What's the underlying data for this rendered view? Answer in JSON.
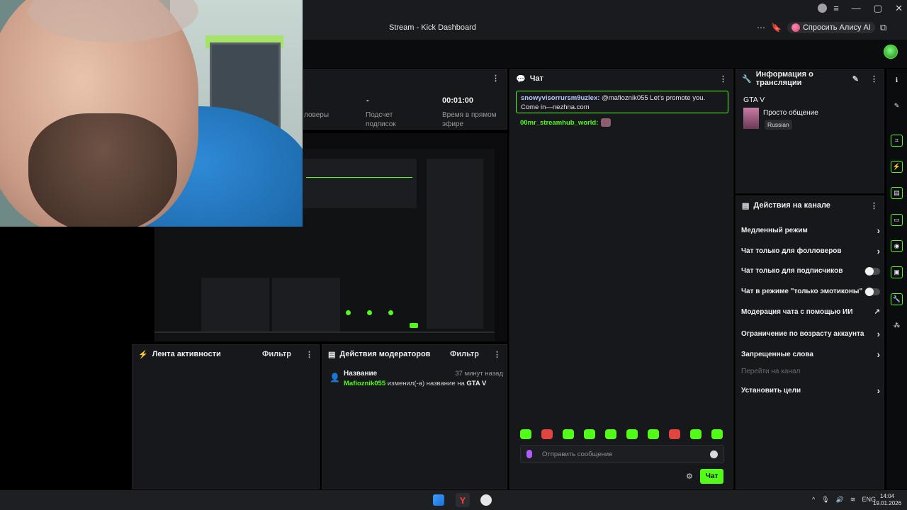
{
  "browser": {
    "page_title": "Stream - Kick Dashboard",
    "alice_button": "Спросить Алису AI",
    "more_icon": "⋯",
    "window_controls": [
      "≡",
      "—",
      "▢",
      "✕"
    ]
  },
  "stats": {
    "followers_label": "ловеры",
    "subs_value": "-",
    "subs_label_1": "Подсчет",
    "subs_label_2": "подписок",
    "live_value": "00:01:00",
    "live_label_1": "Время в прямом",
    "live_label_2": "эфире"
  },
  "chat": {
    "title": "Чат",
    "pinned_user": "snowyvisorrursm9uzlex:",
    "pinned_text": "@mafioznik055 Let's promote you. Come in—nezhna.com",
    "message_user": "00mr_streamhub_world:",
    "input_placeholder": "Отправить сообщение",
    "send_label": "Чат"
  },
  "stream_info": {
    "title": "Информация о трансляции",
    "game": "GTA V",
    "category": "Просто общение",
    "language": "Russian"
  },
  "channel_actions": {
    "title": "Действия на канале",
    "items": [
      {
        "label": "Медленный режим"
      },
      {
        "label": "Чат только для фолловеров"
      },
      {
        "label": "Чат только для подписчиков"
      },
      {
        "label": "Чат в режиме \"только эмотиконы\""
      },
      {
        "label": "Модерация чата с помощью ИИ"
      },
      {
        "label": "Ограничение по возрасту аккаунта"
      },
      {
        "label": "Запрещенные слова"
      },
      {
        "label": "Перейти на канал"
      },
      {
        "label": "Установить цели"
      }
    ]
  },
  "activity_feed": {
    "title": "Лента активности",
    "filter_label": "Фильтр"
  },
  "mod_actions": {
    "title": "Действия модераторов",
    "filter_label": "Фильтр",
    "entry_title": "Название",
    "entry_time": "37 минут назад",
    "entry_user": "Mafioznik055",
    "entry_text": "изменил(-а) название на",
    "entry_value": "GTA V"
  },
  "taskbar": {
    "time": "14:04",
    "date": "19.01.2026",
    "lang": "ENG"
  },
  "colors": {
    "accent": "#53fc18",
    "panel_bg": "#17181b",
    "page_bg": "#000000"
  }
}
